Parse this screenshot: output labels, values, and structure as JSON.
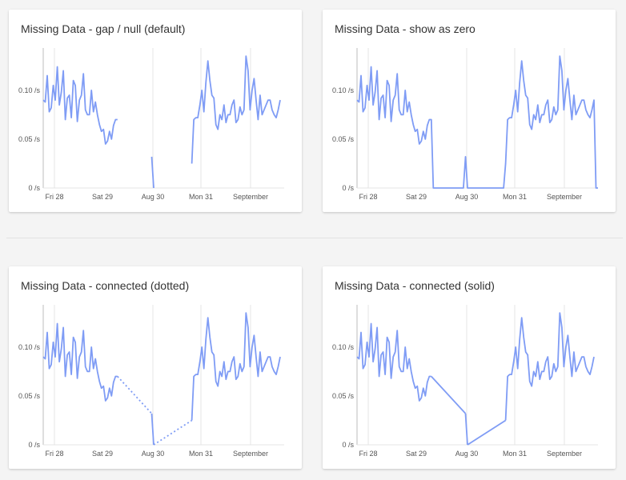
{
  "colors": {
    "series": "#7f9cf5",
    "grid": "#e4e4e4",
    "axis": "#bdbdbd"
  },
  "chart_data": [
    {
      "type": "line",
      "title": "Missing Data - gap / null (default)",
      "mode": "gap",
      "y_ticks": [
        "0 /s",
        "0.05 /s",
        "0.10 /s"
      ],
      "x_ticks": [
        "Fri 28",
        "Sat 29",
        "Aug 30",
        "Mon 31",
        "September"
      ],
      "ylim": [
        0,
        0.14
      ],
      "x": [
        0,
        1,
        2,
        3,
        4,
        5,
        6,
        7,
        8,
        9,
        10,
        11,
        12,
        13,
        14,
        15,
        16,
        17,
        18,
        19,
        20,
        21,
        22,
        23,
        24,
        25,
        26,
        27,
        28,
        29,
        30,
        31,
        32,
        33,
        34,
        35,
        36,
        37,
        38,
        39,
        40,
        41,
        42,
        43,
        44,
        45,
        46,
        47,
        48,
        49,
        50,
        51,
        52,
        53,
        54,
        55,
        56,
        57,
        58,
        59,
        60,
        61,
        62,
        63,
        64,
        65,
        66,
        67,
        68,
        69,
        70,
        71,
        72,
        73,
        74,
        75,
        76,
        77,
        78,
        79,
        80,
        81,
        82,
        83,
        84,
        85,
        86,
        87,
        88,
        89,
        90,
        91,
        92,
        93,
        94,
        95,
        96,
        97,
        98,
        99,
        100,
        101,
        102,
        103,
        104,
        105,
        106,
        107,
        108,
        109,
        110,
        111,
        112,
        113,
        114,
        115,
        116,
        117,
        118,
        119,
        120
      ],
      "y": [
        0.09,
        0.088,
        0.115,
        0.078,
        0.082,
        0.105,
        0.09,
        0.124,
        0.085,
        0.098,
        0.12,
        0.07,
        0.092,
        0.095,
        0.072,
        0.11,
        0.105,
        0.068,
        0.09,
        0.095,
        0.117,
        0.08,
        0.075,
        0.075,
        0.1,
        0.078,
        0.088,
        0.075,
        0.065,
        0.058,
        0.06,
        0.045,
        0.048,
        0.058,
        0.05,
        0.064,
        0.07,
        0.07,
        null,
        null,
        null,
        null,
        null,
        null,
        null,
        null,
        null,
        null,
        null,
        null,
        null,
        null,
        null,
        null,
        0.032,
        0.0,
        null,
        null,
        null,
        null,
        null,
        null,
        null,
        null,
        null,
        null,
        null,
        null,
        null,
        null,
        null,
        null,
        null,
        null,
        0.025,
        0.07,
        0.072,
        0.072,
        0.085,
        0.1,
        0.078,
        0.108,
        0.13,
        0.11,
        0.095,
        0.092,
        0.065,
        0.06,
        0.075,
        0.07,
        0.085,
        0.067,
        0.075,
        0.075,
        0.085,
        0.09,
        0.067,
        0.07,
        0.083,
        0.075,
        0.08,
        0.135,
        0.12,
        0.08,
        0.1,
        0.112,
        0.09,
        0.07,
        0.095,
        0.075,
        0.08,
        0.085,
        0.09,
        0.09,
        0.08,
        0.075,
        0.072,
        0.08,
        0.09
      ]
    },
    {
      "type": "line",
      "title": "Missing Data - show as zero",
      "mode": "zero",
      "y_ticks": [
        "0 /s",
        "0.05 /s",
        "0.10 /s"
      ],
      "x_ticks": [
        "Fri 28",
        "Sat 29",
        "Aug 30",
        "Mon 31",
        "September"
      ],
      "ylim": [
        0,
        0.14
      ],
      "x": [
        0,
        1,
        2,
        3,
        4,
        5,
        6,
        7,
        8,
        9,
        10,
        11,
        12,
        13,
        14,
        15,
        16,
        17,
        18,
        19,
        20,
        21,
        22,
        23,
        24,
        25,
        26,
        27,
        28,
        29,
        30,
        31,
        32,
        33,
        34,
        35,
        36,
        37,
        38,
        39,
        40,
        41,
        42,
        43,
        44,
        45,
        46,
        47,
        48,
        49,
        50,
        51,
        52,
        53,
        54,
        55,
        56,
        57,
        58,
        59,
        60,
        61,
        62,
        63,
        64,
        65,
        66,
        67,
        68,
        69,
        70,
        71,
        72,
        73,
        74,
        75,
        76,
        77,
        78,
        79,
        80,
        81,
        82,
        83,
        84,
        85,
        86,
        87,
        88,
        89,
        90,
        91,
        92,
        93,
        94,
        95,
        96,
        97,
        98,
        99,
        100,
        101,
        102,
        103,
        104,
        105,
        106,
        107,
        108,
        109,
        110,
        111,
        112,
        113,
        114,
        115,
        116,
        117,
        118,
        119,
        120
      ],
      "y": [
        0.09,
        0.088,
        0.115,
        0.078,
        0.082,
        0.105,
        0.09,
        0.124,
        0.085,
        0.098,
        0.12,
        0.07,
        0.092,
        0.095,
        0.072,
        0.11,
        0.105,
        0.068,
        0.09,
        0.095,
        0.117,
        0.08,
        0.075,
        0.075,
        0.1,
        0.078,
        0.088,
        0.075,
        0.065,
        0.058,
        0.06,
        0.045,
        0.048,
        0.058,
        0.05,
        0.064,
        0.07,
        0.07,
        null,
        null,
        null,
        null,
        null,
        null,
        null,
        null,
        null,
        null,
        null,
        null,
        null,
        null,
        null,
        null,
        0.032,
        0.0,
        null,
        null,
        null,
        null,
        null,
        null,
        null,
        null,
        null,
        null,
        null,
        null,
        null,
        null,
        null,
        null,
        null,
        null,
        0.025,
        0.07,
        0.072,
        0.072,
        0.085,
        0.1,
        0.078,
        0.108,
        0.13,
        0.11,
        0.095,
        0.092,
        0.065,
        0.06,
        0.075,
        0.07,
        0.085,
        0.067,
        0.075,
        0.075,
        0.085,
        0.09,
        0.067,
        0.07,
        0.083,
        0.075,
        0.08,
        0.135,
        0.12,
        0.08,
        0.1,
        0.112,
        0.09,
        0.07,
        0.095,
        0.075,
        0.08,
        0.085,
        0.09,
        0.09,
        0.08,
        0.075,
        0.072,
        0.08,
        0.09
      ]
    },
    {
      "type": "line",
      "title": "Missing Data - connected (dotted)",
      "mode": "dotted",
      "y_ticks": [
        "0 /s",
        "0.05 /s",
        "0.10 /s"
      ],
      "x_ticks": [
        "Fri 28",
        "Sat 29",
        "Aug 30",
        "Mon 31",
        "September"
      ],
      "ylim": [
        0,
        0.14
      ],
      "x": [
        0,
        1,
        2,
        3,
        4,
        5,
        6,
        7,
        8,
        9,
        10,
        11,
        12,
        13,
        14,
        15,
        16,
        17,
        18,
        19,
        20,
        21,
        22,
        23,
        24,
        25,
        26,
        27,
        28,
        29,
        30,
        31,
        32,
        33,
        34,
        35,
        36,
        37,
        38,
        39,
        40,
        41,
        42,
        43,
        44,
        45,
        46,
        47,
        48,
        49,
        50,
        51,
        52,
        53,
        54,
        55,
        56,
        57,
        58,
        59,
        60,
        61,
        62,
        63,
        64,
        65,
        66,
        67,
        68,
        69,
        70,
        71,
        72,
        73,
        74,
        75,
        76,
        77,
        78,
        79,
        80,
        81,
        82,
        83,
        84,
        85,
        86,
        87,
        88,
        89,
        90,
        91,
        92,
        93,
        94,
        95,
        96,
        97,
        98,
        99,
        100,
        101,
        102,
        103,
        104,
        105,
        106,
        107,
        108,
        109,
        110,
        111,
        112,
        113,
        114,
        115,
        116,
        117,
        118,
        119,
        120
      ],
      "y": [
        0.09,
        0.088,
        0.115,
        0.078,
        0.082,
        0.105,
        0.09,
        0.124,
        0.085,
        0.098,
        0.12,
        0.07,
        0.092,
        0.095,
        0.072,
        0.11,
        0.105,
        0.068,
        0.09,
        0.095,
        0.117,
        0.08,
        0.075,
        0.075,
        0.1,
        0.078,
        0.088,
        0.075,
        0.065,
        0.058,
        0.06,
        0.045,
        0.048,
        0.058,
        0.05,
        0.064,
        0.07,
        0.07,
        null,
        null,
        null,
        null,
        null,
        null,
        null,
        null,
        null,
        null,
        null,
        null,
        null,
        null,
        null,
        null,
        0.032,
        0.0,
        null,
        null,
        null,
        null,
        null,
        null,
        null,
        null,
        null,
        null,
        null,
        null,
        null,
        null,
        null,
        null,
        null,
        null,
        0.025,
        0.07,
        0.072,
        0.072,
        0.085,
        0.1,
        0.078,
        0.108,
        0.13,
        0.11,
        0.095,
        0.092,
        0.065,
        0.06,
        0.075,
        0.07,
        0.085,
        0.067,
        0.075,
        0.075,
        0.085,
        0.09,
        0.067,
        0.07,
        0.083,
        0.075,
        0.08,
        0.135,
        0.12,
        0.08,
        0.1,
        0.112,
        0.09,
        0.07,
        0.095,
        0.075,
        0.08,
        0.085,
        0.09,
        0.09,
        0.08,
        0.075,
        0.072,
        0.08,
        0.09
      ]
    },
    {
      "type": "line",
      "title": "Missing Data - connected (solid)",
      "mode": "solid",
      "y_ticks": [
        "0 /s",
        "0.05 /s",
        "0.10 /s"
      ],
      "x_ticks": [
        "Fri 28",
        "Sat 29",
        "Aug 30",
        "Mon 31",
        "September"
      ],
      "ylim": [
        0,
        0.14
      ],
      "x": [
        0,
        1,
        2,
        3,
        4,
        5,
        6,
        7,
        8,
        9,
        10,
        11,
        12,
        13,
        14,
        15,
        16,
        17,
        18,
        19,
        20,
        21,
        22,
        23,
        24,
        25,
        26,
        27,
        28,
        29,
        30,
        31,
        32,
        33,
        34,
        35,
        36,
        37,
        38,
        39,
        40,
        41,
        42,
        43,
        44,
        45,
        46,
        47,
        48,
        49,
        50,
        51,
        52,
        53,
        54,
        55,
        56,
        57,
        58,
        59,
        60,
        61,
        62,
        63,
        64,
        65,
        66,
        67,
        68,
        69,
        70,
        71,
        72,
        73,
        74,
        75,
        76,
        77,
        78,
        79,
        80,
        81,
        82,
        83,
        84,
        85,
        86,
        87,
        88,
        89,
        90,
        91,
        92,
        93,
        94,
        95,
        96,
        97,
        98,
        99,
        100,
        101,
        102,
        103,
        104,
        105,
        106,
        107,
        108,
        109,
        110,
        111,
        112,
        113,
        114,
        115,
        116,
        117,
        118,
        119,
        120
      ],
      "y": [
        0.09,
        0.088,
        0.115,
        0.078,
        0.082,
        0.105,
        0.09,
        0.124,
        0.085,
        0.098,
        0.12,
        0.07,
        0.092,
        0.095,
        0.072,
        0.11,
        0.105,
        0.068,
        0.09,
        0.095,
        0.117,
        0.08,
        0.075,
        0.075,
        0.1,
        0.078,
        0.088,
        0.075,
        0.065,
        0.058,
        0.06,
        0.045,
        0.048,
        0.058,
        0.05,
        0.064,
        0.07,
        0.07,
        null,
        null,
        null,
        null,
        null,
        null,
        null,
        null,
        null,
        null,
        null,
        null,
        null,
        null,
        null,
        null,
        0.032,
        0.0,
        null,
        null,
        null,
        null,
        null,
        null,
        null,
        null,
        null,
        null,
        null,
        null,
        null,
        null,
        null,
        null,
        null,
        null,
        0.025,
        0.07,
        0.072,
        0.072,
        0.085,
        0.1,
        0.078,
        0.108,
        0.13,
        0.11,
        0.095,
        0.092,
        0.065,
        0.06,
        0.075,
        0.07,
        0.085,
        0.067,
        0.075,
        0.075,
        0.085,
        0.09,
        0.067,
        0.07,
        0.083,
        0.075,
        0.08,
        0.135,
        0.12,
        0.08,
        0.1,
        0.112,
        0.09,
        0.07,
        0.095,
        0.075,
        0.08,
        0.085,
        0.09,
        0.09,
        0.08,
        0.075,
        0.072,
        0.08,
        0.09
      ]
    }
  ]
}
